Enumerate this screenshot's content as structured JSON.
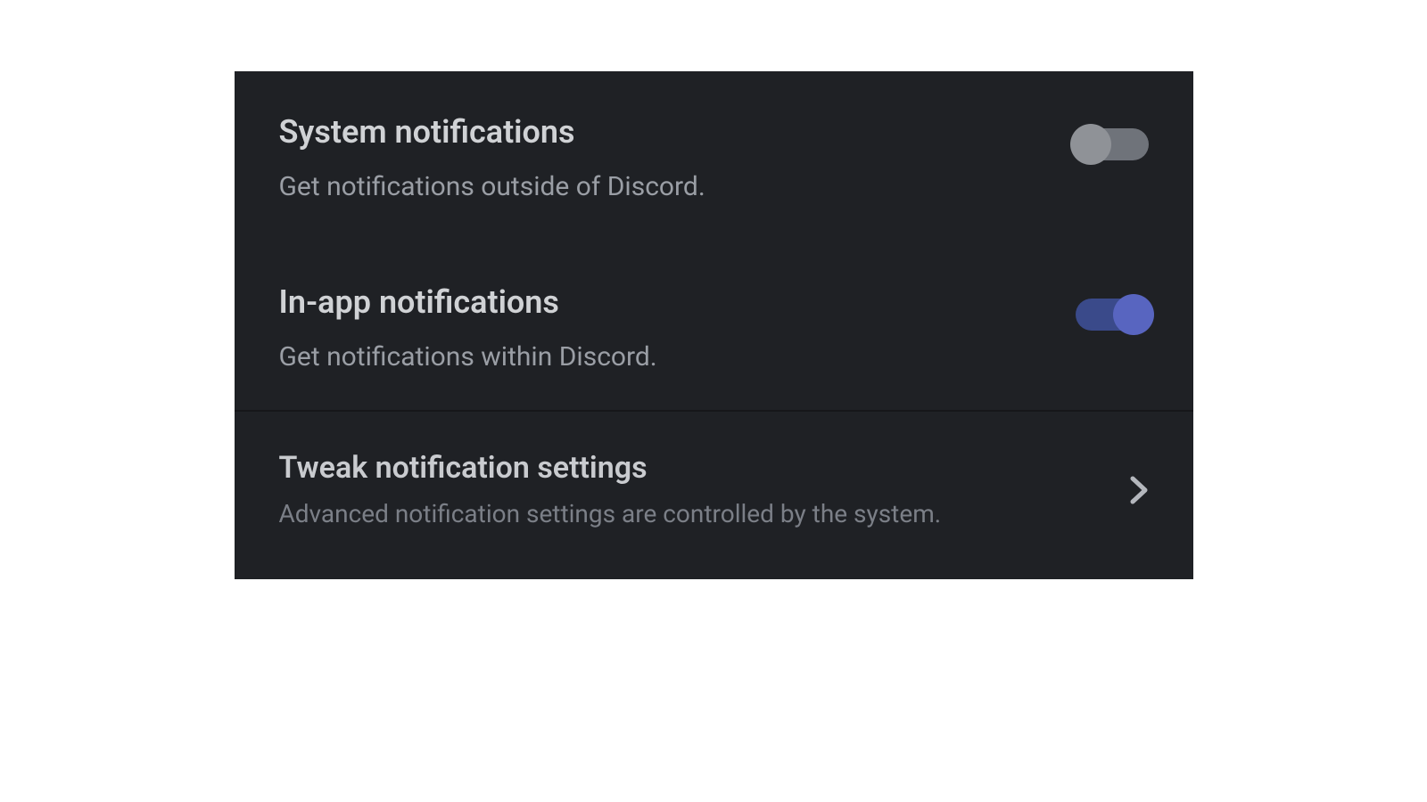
{
  "settings": {
    "system_notifications": {
      "title": "System notifications",
      "subtitle": "Get notifications outside of Discord.",
      "enabled": false
    },
    "in_app_notifications": {
      "title": "In-app notifications",
      "subtitle": "Get notifications within Discord.",
      "enabled": true
    },
    "tweak": {
      "title": "Tweak notification settings",
      "subtitle": "Advanced notification settings are controlled by the system."
    }
  },
  "colors": {
    "panel_bg": "#1f2125",
    "title": "#d0d2d5",
    "subtitle": "#9a9ea5",
    "muted": "#7b7f87",
    "toggle_on_track": "#3a4a8a",
    "toggle_on_knob": "#5865c0",
    "toggle_off_track": "#6f737a",
    "toggle_off_knob": "#8f9297"
  }
}
